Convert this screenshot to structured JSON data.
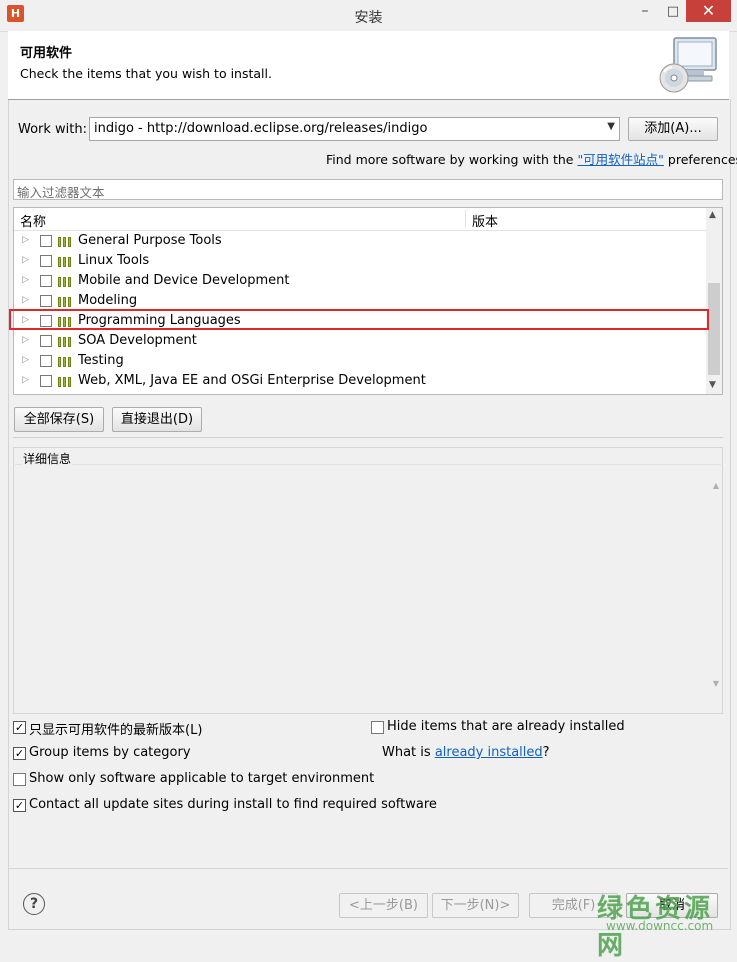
{
  "window": {
    "title": "安装",
    "minimize": "–",
    "maximize": "□",
    "close": "✕",
    "app_icon": "H"
  },
  "header": {
    "title": "可用软件",
    "subtitle": "Check the items that you wish to install."
  },
  "work_with": {
    "label": "Work with:",
    "value": "indigo - http://download.eclipse.org/releases/indigo",
    "add_button": "添加(A)..."
  },
  "find_more": {
    "prefix": "Find more software by working with the ",
    "link": "\"可用软件站点\"",
    "suffix": " preferences."
  },
  "filter": {
    "placeholder": "输入过滤器文本"
  },
  "tree": {
    "columns": [
      "名称",
      "版本"
    ],
    "items": [
      {
        "label": "General Purpose Tools"
      },
      {
        "label": "Linux Tools"
      },
      {
        "label": "Mobile and Device Development"
      },
      {
        "label": "Modeling"
      },
      {
        "label": "Programming Languages"
      },
      {
        "label": "SOA Development"
      },
      {
        "label": "Testing"
      },
      {
        "label": "Web, XML, Java EE and OSGi Enterprise Development"
      }
    ],
    "highlighted_item": "Programming Languages"
  },
  "buttons": {
    "select_all": "全部保存(S)",
    "deselect_all": "直接退出(D)"
  },
  "details": {
    "label": "详细信息"
  },
  "options": {
    "show_latest": {
      "label": "只显示可用软件的最新版本(L)",
      "checked": true
    },
    "group_by_category": {
      "label": "Group items by category",
      "checked": true
    },
    "show_applicable": {
      "label": "Show only software applicable to target environment",
      "checked": false
    },
    "contact_sites": {
      "label": "Contact all update sites during install to find required software",
      "checked": true
    },
    "hide_installed": {
      "label": "Hide items that are already installed",
      "checked": false
    },
    "what_is": {
      "prefix": "What is ",
      "link": "already installed",
      "suffix": "?"
    }
  },
  "footer": {
    "help": "?",
    "back": "<上一步(B)",
    "next": "下一步(N)>",
    "finish": "完成(F)",
    "cancel": "取消"
  },
  "watermark": {
    "main": "绿色资源网",
    "sub": "www.downcc.com"
  },
  "colors": {
    "highlight": "#e02828",
    "link": "#1060c0",
    "close": "#c7413a"
  }
}
